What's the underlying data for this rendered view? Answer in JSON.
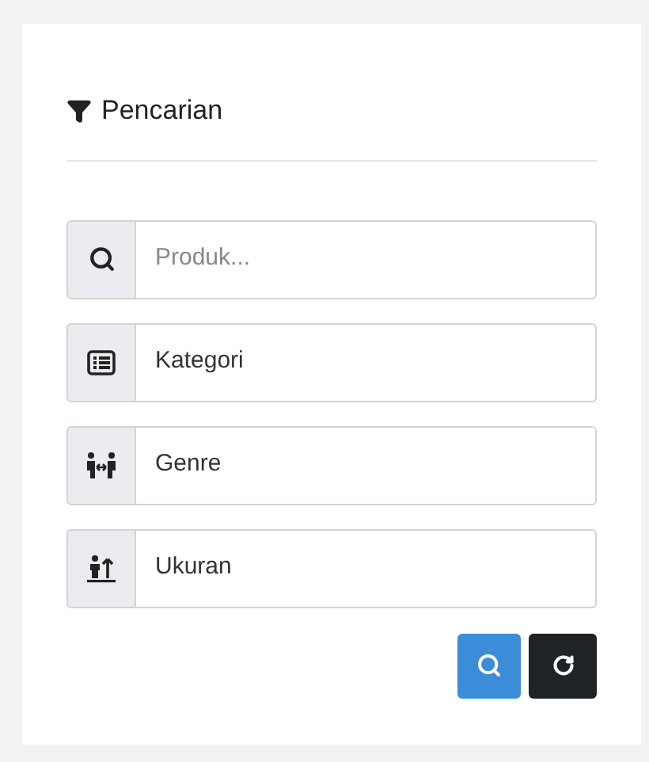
{
  "panel": {
    "title": "Pencarian"
  },
  "fields": [
    {
      "kind": "input",
      "placeholder": "Produk..."
    },
    {
      "kind": "select",
      "value": "Kategori"
    },
    {
      "kind": "select",
      "value": "Genre"
    },
    {
      "kind": "select",
      "value": "Ukuran"
    }
  ],
  "buttons": [
    {
      "kind": "search"
    },
    {
      "kind": "reset"
    }
  ]
}
